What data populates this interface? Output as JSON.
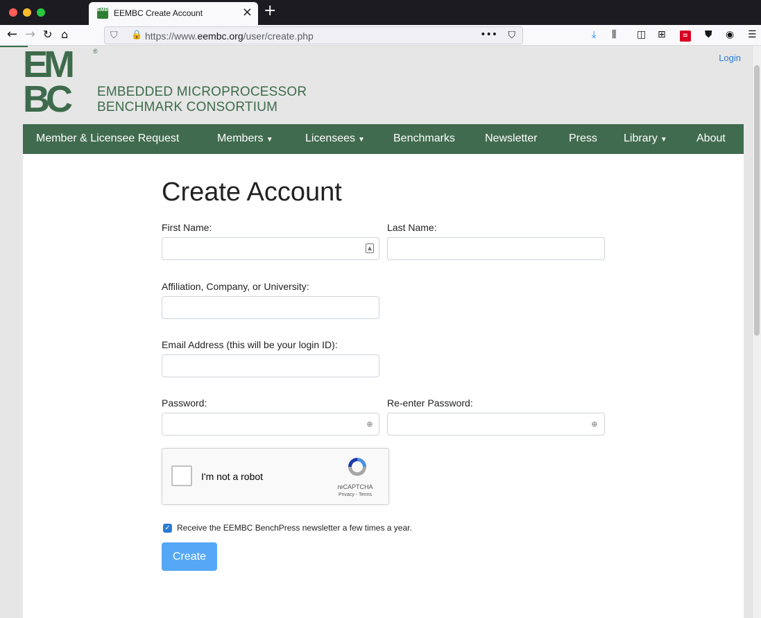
{
  "browser": {
    "tab_title": "EEMBC Create Account",
    "tab_favicon_text": "EMBC",
    "url_prefix": "https://www.",
    "url_domain": "eembc.org",
    "url_path": "/user/create.php",
    "toolbar_badge": "5"
  },
  "site": {
    "logo_letters_top": "EM",
    "logo_letters_bottom": "BC",
    "logo_registered": "®",
    "logo_line1": "EMBEDDED MICROPROCESSOR",
    "logo_line2": "BENCHMARK CONSORTIUM",
    "login": "Login",
    "brand_color": "#416b4f"
  },
  "nav": {
    "items": [
      {
        "label": "Member & Licensee Request",
        "dropdown": false
      },
      {
        "label": "Members",
        "dropdown": true
      },
      {
        "label": "Licensees",
        "dropdown": true
      },
      {
        "label": "Benchmarks",
        "dropdown": false
      },
      {
        "label": "Newsletter",
        "dropdown": false
      },
      {
        "label": "Press",
        "dropdown": false
      },
      {
        "label": "Library",
        "dropdown": true
      },
      {
        "label": "About",
        "dropdown": false
      }
    ]
  },
  "form": {
    "title": "Create Account",
    "first_name_label": "First Name:",
    "first_name_value": "",
    "last_name_label": "Last Name:",
    "last_name_value": "",
    "affiliation_label": "Affiliation, Company, or University:",
    "affiliation_value": "",
    "email_label": "Email Address (this will be your login ID):",
    "email_value": "",
    "password_label": "Password:",
    "password_value": "",
    "reenter_label": "Re-enter Password:",
    "reenter_value": "",
    "captcha_label": "I'm not a robot",
    "captcha_brand": "reCAPTCHA",
    "captcha_links": "Privacy - Terms",
    "newsletter_checked": true,
    "newsletter_label": "Receive the EEMBC BenchPress newsletter a few times a year.",
    "submit_label": "Create",
    "submit_color": "#55a8f6"
  }
}
